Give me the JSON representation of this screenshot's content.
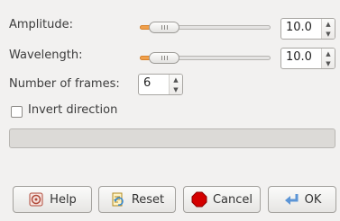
{
  "amplitude": {
    "label": "Amplitude:",
    "value": "10.0",
    "level": 0.1
  },
  "wavelength": {
    "label": "Wavelength:",
    "value": "10.0",
    "level": 0.1
  },
  "frames": {
    "label": "Number of frames:",
    "value": "6"
  },
  "invert": {
    "label": "Invert direction",
    "checked": false
  },
  "progress": {
    "level": 0
  },
  "buttons": {
    "help": "Help",
    "reset": "Reset",
    "cancel": "Cancel",
    "ok": "OK"
  },
  "icons": {
    "help": "help-icon",
    "reset": "reset-icon",
    "cancel": "cancel-icon",
    "ok": "ok-icon"
  },
  "colors": {
    "accent": "#f0a04b",
    "cancel_red": "#d40000"
  }
}
